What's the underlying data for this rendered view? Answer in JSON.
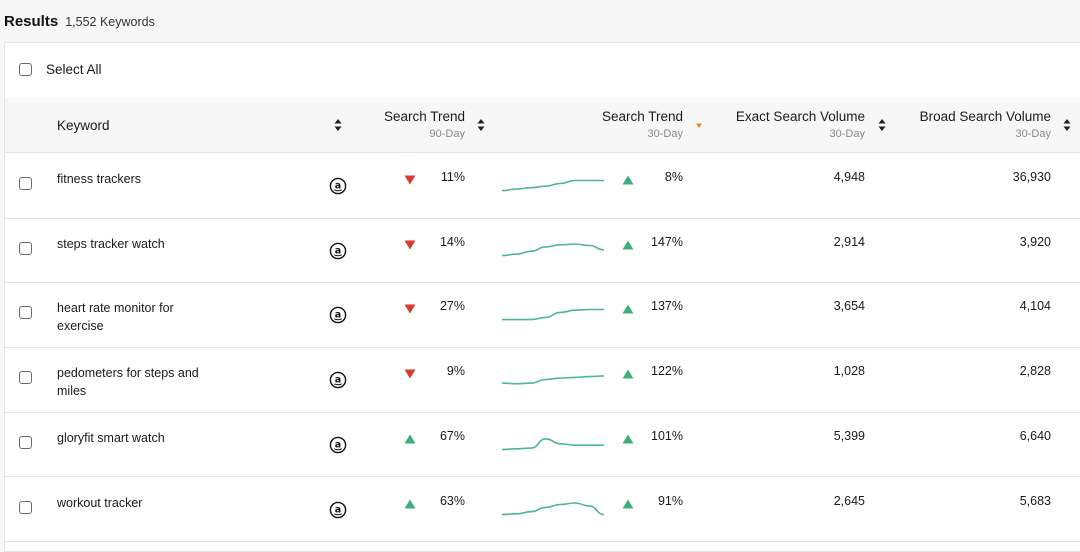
{
  "header": {
    "title": "Results",
    "count": "1,552 Keywords"
  },
  "select_all": {
    "label": "Select All"
  },
  "columns": {
    "keyword": {
      "label": "Keyword"
    },
    "trend90": {
      "label": "Search Trend",
      "sub": "90-Day"
    },
    "trend30": {
      "label": "Search Trend",
      "sub": "30-Day"
    },
    "exact": {
      "label": "Exact Search Volume",
      "sub": "30-Day"
    },
    "broad": {
      "label": "Broad Search Volume",
      "sub": "30-Day"
    }
  },
  "colors": {
    "down": "#d63b2f",
    "up": "#3fae7a",
    "spark": "#4cb88b",
    "sort_active": "#e08a2f"
  },
  "rows": [
    {
      "keyword": "fitness trackers",
      "t90_dir": "down",
      "t90": "11%",
      "t30_dir": "up",
      "t30": "8%",
      "exact": "4,948",
      "broad": "36,930",
      "spark": [
        0.1,
        0.2,
        0.3,
        0.4,
        0.6,
        0.8,
        0.8,
        0.8
      ]
    },
    {
      "keyword": "steps tracker watch",
      "t90_dir": "down",
      "t90": "14%",
      "t30_dir": "up",
      "t30": "147%",
      "exact": "2,914",
      "broad": "3,920",
      "spark": [
        0.1,
        0.2,
        0.4,
        0.7,
        0.85,
        0.9,
        0.8,
        0.5
      ]
    },
    {
      "keyword": "heart rate monitor for exercise",
      "t90_dir": "down",
      "t90": "27%",
      "t30_dir": "up",
      "t30": "137%",
      "exact": "3,654",
      "broad": "4,104",
      "spark": [
        0.1,
        0.1,
        0.1,
        0.25,
        0.6,
        0.75,
        0.8,
        0.8
      ]
    },
    {
      "keyword": "pedometers for steps and miles",
      "t90_dir": "down",
      "t90": "9%",
      "t30_dir": "up",
      "t30": "122%",
      "exact": "1,028",
      "broad": "2,828",
      "spark": [
        0.2,
        0.15,
        0.2,
        0.45,
        0.55,
        0.6,
        0.65,
        0.7
      ]
    },
    {
      "keyword": "gloryfit smart watch",
      "t90_dir": "up",
      "t90": "67%",
      "t30_dir": "up",
      "t30": "101%",
      "exact": "5,399",
      "broad": "6,640",
      "spark": [
        0.1,
        0.15,
        0.2,
        0.85,
        0.5,
        0.4,
        0.4,
        0.4
      ]
    },
    {
      "keyword": "workout tracker",
      "t90_dir": "up",
      "t90": "63%",
      "t30_dir": "up",
      "t30": "91%",
      "exact": "2,645",
      "broad": "5,683",
      "spark": [
        0.1,
        0.15,
        0.3,
        0.6,
        0.8,
        0.9,
        0.7,
        0.1
      ]
    }
  ]
}
